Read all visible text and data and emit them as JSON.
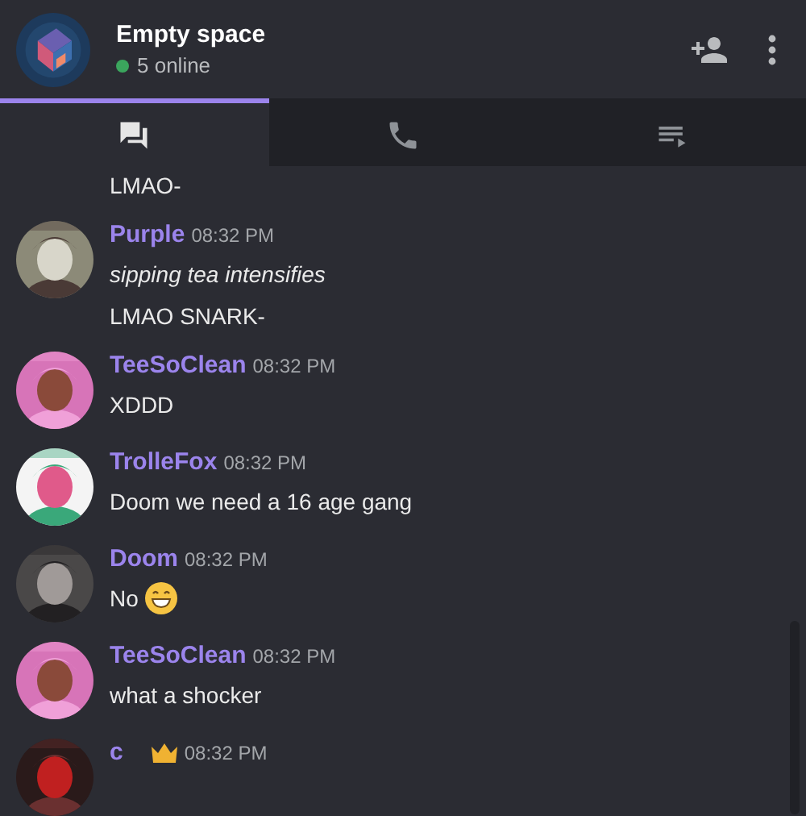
{
  "header": {
    "title": "Empty space",
    "status": "5 online"
  },
  "tabs": [
    {
      "selected": true
    },
    {
      "selected": false
    },
    {
      "selected": false
    }
  ],
  "messages": [
    {
      "lines": [
        {
          "text": "LMAO-",
          "kind": "plain"
        }
      ]
    },
    {
      "author": "Purple",
      "time": "08:32 PM",
      "crown": false,
      "lines": [
        {
          "text": "sipping tea intensifies",
          "kind": "italic"
        },
        {
          "text": "LMAO SNARK-",
          "kind": "plain"
        }
      ]
    },
    {
      "author": "TeeSoClean",
      "time": "08:32 PM",
      "crown": false,
      "lines": [
        {
          "text": "XDDD",
          "kind": "plain"
        }
      ]
    },
    {
      "author": "TrolleFox",
      "time": "08:32 PM",
      "crown": false,
      "lines": [
        {
          "text": "Doom we need a 16 age gang",
          "kind": "plain"
        }
      ]
    },
    {
      "author": "Doom",
      "time": "08:32 PM",
      "crown": false,
      "lines": [
        {
          "text": "No",
          "kind": "emoji"
        }
      ]
    },
    {
      "author": "TeeSoClean",
      "time": "08:32 PM",
      "crown": false,
      "lines": [
        {
          "text": "what a shocker",
          "kind": "plain"
        }
      ]
    },
    {
      "author": "c",
      "time": "08:32 PM",
      "crown": true
    }
  ]
}
